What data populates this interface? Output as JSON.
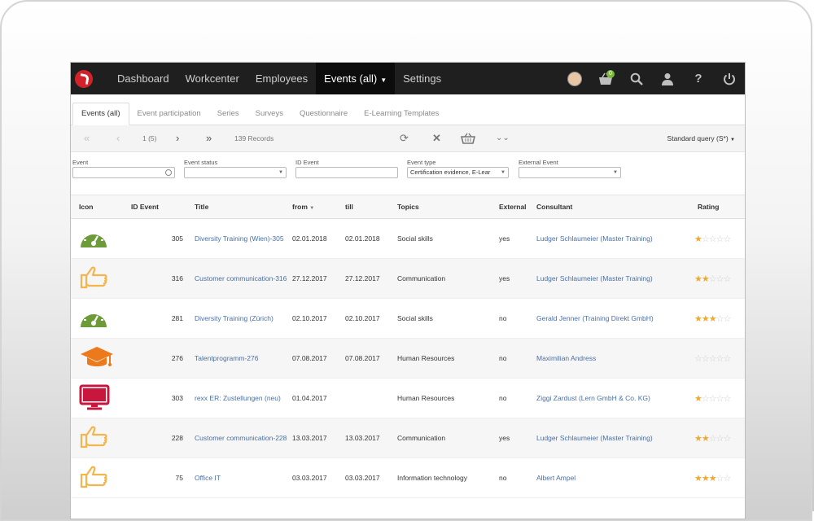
{
  "nav": {
    "items": [
      "Dashboard",
      "Workcenter",
      "Employees",
      "Events (all)",
      "Settings"
    ],
    "active_index": 3,
    "basket_count": "0"
  },
  "subtabs": [
    "Events (all)",
    "Event participation",
    "Series",
    "Surveys",
    "Questionnaire",
    "E-Learning Templates"
  ],
  "toolbar": {
    "page": "1 (5)",
    "records": "139 Records",
    "query": "Standard query (S*)"
  },
  "filters": {
    "event_label": "Event",
    "event_value": "",
    "status_label": "Event status",
    "status_value": "",
    "id_label": "ID Event",
    "id_value": "",
    "type_label": "Event type",
    "type_value": "Certification evidence, E-Lear",
    "external_label": "External Event",
    "external_value": ""
  },
  "table": {
    "headers": [
      "Icon",
      "ID Event",
      "Title",
      "from",
      "till",
      "Topics",
      "External",
      "Consultant",
      "Rating"
    ],
    "rows": [
      {
        "icon": "gauge-icon",
        "id": "305",
        "title": "Diversity Training (Wien)-305",
        "from": "02.01.2018",
        "till": "02.01.2018",
        "topics": "Social skills",
        "external": "yes",
        "consultant": "Ludger Schlaumeier (Master Training)",
        "rating": 1
      },
      {
        "icon": "thumbs-up-icon",
        "id": "316",
        "title": "Customer communication-316",
        "from": "27.12.2017",
        "till": "27.12.2017",
        "topics": "Communication",
        "external": "yes",
        "consultant": "Ludger Schlaumeier (Master Training)",
        "rating": 2
      },
      {
        "icon": "gauge-icon",
        "id": "281",
        "title": "Diversity Training (Zürich)",
        "from": "02.10.2017",
        "till": "02.10.2017",
        "topics": "Social skills",
        "external": "no",
        "consultant": "Gerald Jenner (Training Direkt GmbH)",
        "rating": 3
      },
      {
        "icon": "graduation-cap-icon",
        "id": "276",
        "title": "Talentprogramm-276",
        "from": "07.08.2017",
        "till": "07.08.2017",
        "topics": "Human Resources",
        "external": "no",
        "consultant": "Maximilian Andress",
        "rating": 0
      },
      {
        "icon": "monitor-icon",
        "id": "303",
        "title": "rexx ER: Zustellungen (neu)",
        "from": "01.04.2017",
        "till": "",
        "topics": "Human Resources",
        "external": "no",
        "consultant": "Ziggi Zardust (Lern GmbH & Co. KG)",
        "rating": 1
      },
      {
        "icon": "thumbs-up-icon",
        "id": "228",
        "title": "Customer communication-228",
        "from": "13.03.2017",
        "till": "13.03.2017",
        "topics": "Communication",
        "external": "yes",
        "consultant": "Ludger Schlaumeier (Master Training)",
        "rating": 2
      },
      {
        "icon": "thumbs-up-icon",
        "id": "75",
        "title": "Office IT",
        "from": "03.03.2017",
        "till": "03.03.2017",
        "topics": "Information technology",
        "external": "no",
        "consultant": "Albert Ampel",
        "rating": 3
      }
    ]
  },
  "colors": {
    "nav_bg": "#1f1f1f",
    "gauge_green": "#6e9b3a",
    "thumb_orange": "#f4b54c",
    "cap_orange": "#ec7a1c",
    "monitor_red": "#c8163d",
    "star": "#f0a830",
    "link": "#4a6fa5"
  }
}
